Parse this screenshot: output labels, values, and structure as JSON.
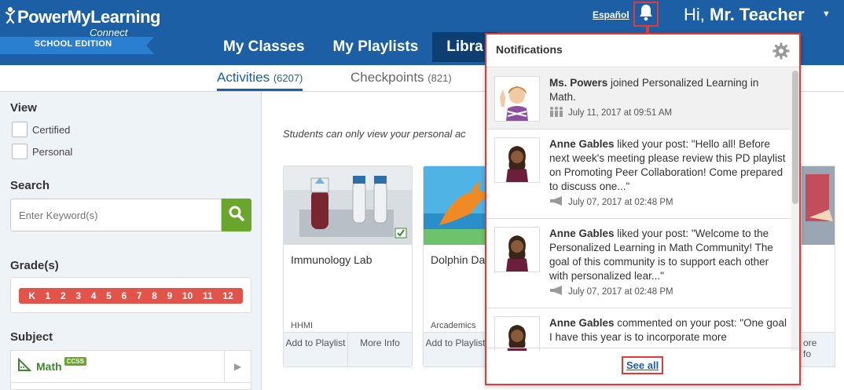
{
  "brand": {
    "name": "PowerMyLearning",
    "sub": "Connect",
    "edition": "SCHOOL EDITION"
  },
  "header": {
    "language_link": "Español",
    "greeting_prefix": "Hi,",
    "user_name": "Mr. Teacher"
  },
  "nav": {
    "items": [
      {
        "label": "My Classes"
      },
      {
        "label": "My Playlists"
      },
      {
        "label": "Libra"
      }
    ]
  },
  "subnav": {
    "tabs": [
      {
        "label": "Activities",
        "count": "(6207)"
      },
      {
        "label": "Checkpoints",
        "count": "(821)"
      }
    ]
  },
  "sidebar": {
    "view_title": "View",
    "view_options": [
      "Certified",
      "Personal"
    ],
    "search_title": "Search",
    "search_placeholder": "Enter Keyword(s)",
    "grades_title": "Grade(s)",
    "grades": [
      "K",
      "1",
      "2",
      "3",
      "4",
      "5",
      "6",
      "7",
      "8",
      "9",
      "10",
      "11",
      "12"
    ],
    "subject_title": "Subject",
    "subject": {
      "label": "Math",
      "badge": "CCSS"
    }
  },
  "main": {
    "notice": "Students can only view your personal ac",
    "cards": [
      {
        "title": "Immunology Lab",
        "publisher": "HHMI",
        "action1": "Add to Playlist",
        "action2": "More Info"
      },
      {
        "title": "Dolphin Da",
        "publisher": "Arcademics",
        "action1": "Add to Playlist",
        "action2": ""
      }
    ],
    "partial_card_action": "ore\nfo"
  },
  "notifications": {
    "title": "Notifications",
    "items": [
      {
        "actor": "Ms. Powers",
        "text": " joined Personalized Learning in Math.",
        "time": "July 11, 2017 at 09:51 AM",
        "icon": "people-icon"
      },
      {
        "actor": "Anne Gables",
        "text": " liked your post: \"Hello all! Before next week's meeting please review this PD playlist on Promoting Peer Collaboration! Come prepared to discuss one...\"",
        "time": "July 07, 2017 at 02:48 PM",
        "icon": "megaphone-icon"
      },
      {
        "actor": "Anne Gables",
        "text": " liked your post: \"Welcome to the Personalized Learning in Math Community! The goal of this community is to support each other with personalized lear...\"",
        "time": "July 07, 2017 at 02:48 PM",
        "icon": "megaphone-icon"
      },
      {
        "actor": "Anne Gables",
        "text": " commented on your post: \"One goal I have this year is to incorporate more",
        "time": "",
        "icon": ""
      }
    ],
    "see_all": "See all"
  },
  "colors": {
    "brand_blue": "#1c5fa4",
    "highlight_red": "#e53935",
    "search_green": "#6aa52c"
  }
}
